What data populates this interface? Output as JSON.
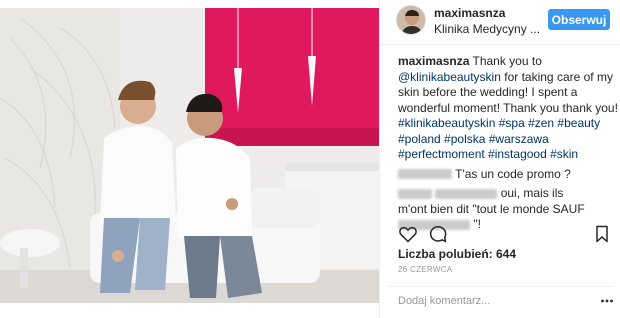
{
  "post": {
    "photo_alt": "",
    "header": {
      "username": "maximasnza",
      "location": "Klinika Medycyny ...",
      "follow_label": "Obserwuj"
    },
    "caption": {
      "username": "maximasnza",
      "lines": [
        "Thank you to",
        "@klinikabeautyskin",
        "for taking care of my",
        "skin before the wedding! I spent a",
        "wonderful moment! Thank you thank you!",
        "#klinikabeautyskin #spa #zen #beauty",
        "#poland #polska #warszawa",
        "#perfectmoment #instagood #skin"
      ]
    },
    "comments": [
      {
        "text": "T'as un code promo ?"
      },
      {
        "text_1": "oui, mais ils",
        "text_2": "m'ont bien dit \"tout le monde SAUF",
        "text_3": "\"!"
      }
    ],
    "likes_text": "Liczba polubień: 644",
    "date_text": "26 CZERWCA",
    "add_comment_placeholder": "Dodaj komentarz...",
    "icons": [
      "heart-icon",
      "comment-icon",
      "bookmark-icon",
      "more-options-icon"
    ],
    "colors": {
      "accent": "#3897f0",
      "hashtag": "#003569",
      "wall_pink": "#e0195f"
    }
  }
}
